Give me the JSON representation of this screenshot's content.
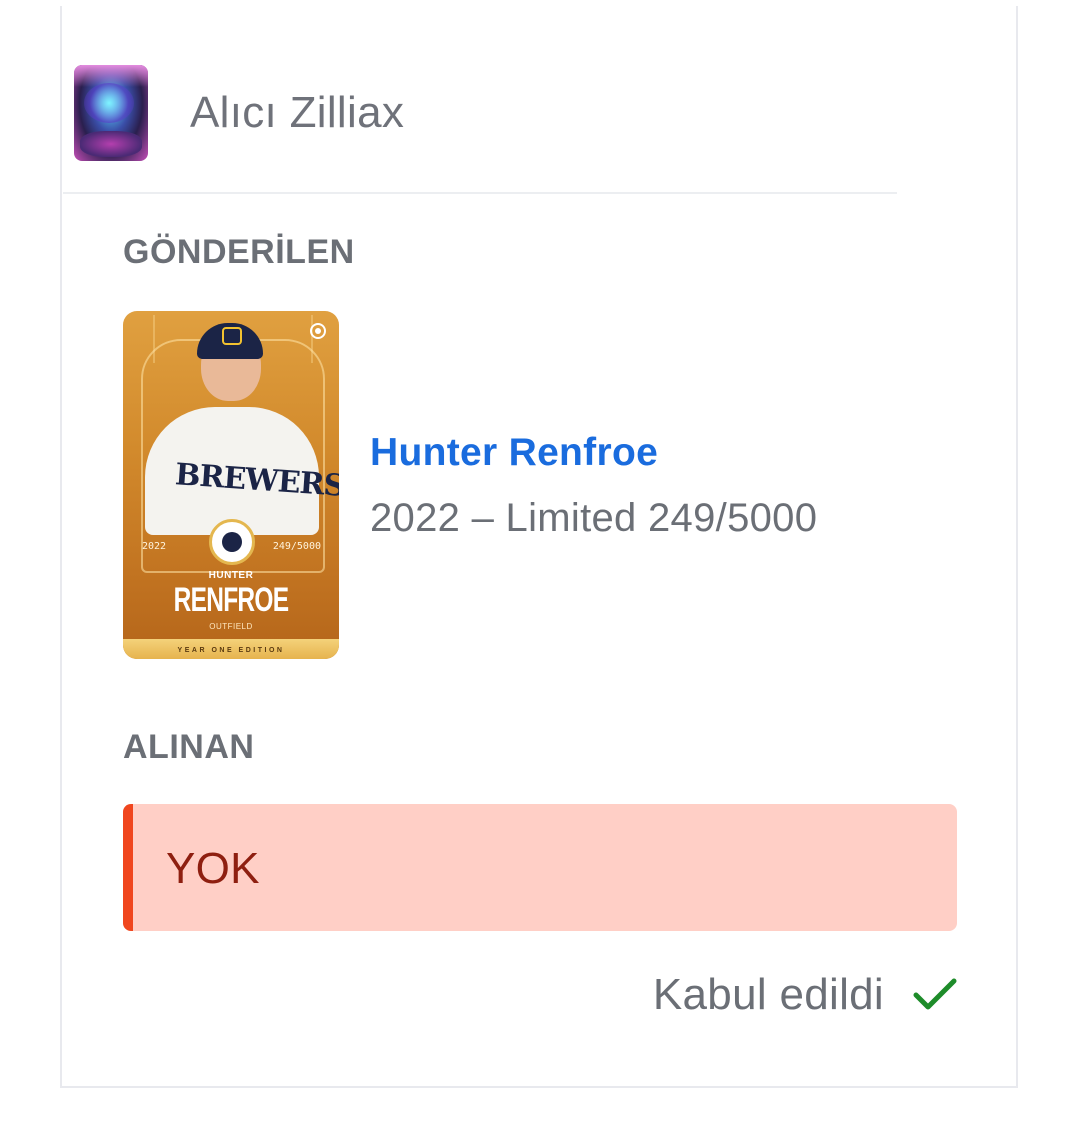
{
  "header": {
    "buyer_label": "Alıcı Zilliax"
  },
  "sent": {
    "section_label": "GÖNDERİLEN",
    "card": {
      "year": "2022",
      "serial": "249/5000",
      "first_name": "HUNTER",
      "last_name": "RENFROE",
      "position": "OUTFIELD",
      "edition": "YEAR ONE EDITION",
      "jersey_text": "BREWERS"
    },
    "player_name": "Hunter Renfroe",
    "player_meta": "2022 – Limited 249/5000"
  },
  "received": {
    "section_label": "ALINAN",
    "none_text": "YOK"
  },
  "status": {
    "label": "Kabul edildi"
  },
  "colors": {
    "link_blue": "#1a6cde",
    "muted_text": "#6b6f76",
    "alert_bg": "#ffcfc6",
    "alert_bar": "#f0461e",
    "alert_text": "#8e1f10",
    "success_green": "#1e8c2a",
    "card_gold": "#d28a2c"
  },
  "icons": {
    "status": "check-icon",
    "avatar": "user-avatar-image"
  }
}
